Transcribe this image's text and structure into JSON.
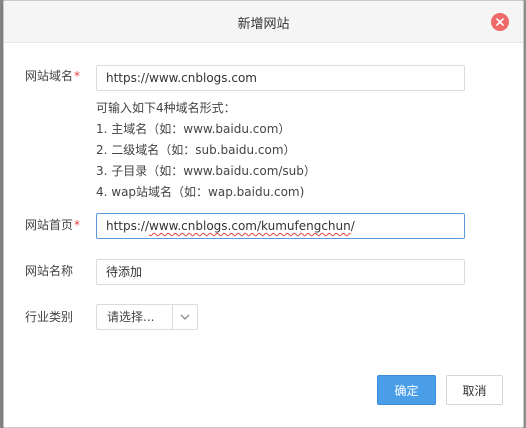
{
  "dialog": {
    "title": "新增网站"
  },
  "form": {
    "domain": {
      "label": "网站域名",
      "required_mark": "*",
      "value": "https://www.cnblogs.com"
    },
    "hints": {
      "intro": "可输入如下4种域名形式：",
      "items": [
        "1. 主域名（如：www.baidu.com）",
        "2. 二级域名（如：sub.baidu.com）",
        "3. 子目录（如：www.baidu.com/sub）",
        "4. wap站域名（如：wap.baidu.com)"
      ]
    },
    "homepage": {
      "label": "网站首页",
      "required_mark": "*",
      "value_prefix": "https://",
      "value_underlined": "www.cnblogs.com/kumufengchun",
      "value_suffix": "/"
    },
    "site_name": {
      "label": "网站名称",
      "value": "待添加"
    },
    "industry": {
      "label": "行业类别",
      "selected": "请选择..."
    }
  },
  "footer": {
    "confirm_label": "确定",
    "cancel_label": "取消"
  },
  "colors": {
    "primary": "#4a9ee8",
    "close": "#f06a6a",
    "required": "#e64545"
  },
  "icons": {
    "close": "close-icon",
    "dropdown": "chevron-down-icon"
  }
}
